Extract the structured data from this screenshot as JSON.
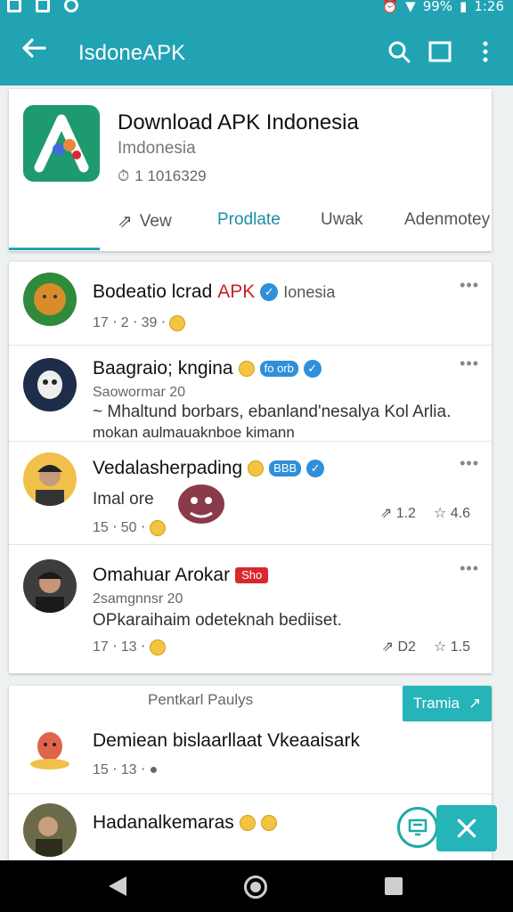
{
  "statusbar": {
    "battery": "99%",
    "time": "1:26"
  },
  "appbar": {
    "title": "IsdoneAPK"
  },
  "hero": {
    "title": "Download APK Indonesia",
    "subtitle": "Imdonesia",
    "count": "1 1016329",
    "tabs": [
      "Vew",
      "Prodlate",
      "Uwak",
      "Adenmotey"
    ]
  },
  "posts": [
    {
      "name_a": "Bodeatio lcrad",
      "name_b": "APK",
      "extra": "Ionesia",
      "meta": "17 ⋅ 2 ⋅ 39 ⋅",
      "lines": []
    },
    {
      "name_a": "Baagraio; kngina",
      "badge": "fo orb",
      "meta": "Saowormar 20",
      "lines": [
        "~ Mhaltund borbars, ebanland'nesalya Kol Arlia.",
        "mokan aulmauaknboe kimann"
      ]
    },
    {
      "name_a": "Vedalasherpading",
      "badge": "BBB",
      "meta": "Imal ore",
      "meta2": "15 ⋅ 50 ⋅",
      "stats": [
        "1.2",
        "4.6"
      ]
    },
    {
      "name_a": "Omahuar Arokar",
      "tag": "Sho",
      "meta": "2samgnnsr 20",
      "lines": [
        "OPkaraihaim odeteknah bediiset."
      ],
      "meta2": "17 ⋅ 13 ⋅",
      "stats": [
        "D2",
        "1.5"
      ]
    }
  ],
  "bottom": {
    "section_title": "Pentkarl Paulys",
    "button_label": "Tramia",
    "items": [
      {
        "title": "Demiean bislaarllaat Vkeaaisark",
        "meta": "15 ⋅ 13 ⋅"
      },
      {
        "title": "Hadanalkemaras"
      }
    ]
  },
  "colors": {
    "teal": "#21a3b3",
    "accent_blue": "#2f8fd8",
    "red": "#d9272e"
  },
  "icons": {
    "appbar": [
      "back-arrow-icon",
      "search-icon",
      "window-icon",
      "more-vert-icon"
    ],
    "nav": [
      "nav-back-icon",
      "nav-home-icon",
      "nav-recent-icon"
    ]
  }
}
